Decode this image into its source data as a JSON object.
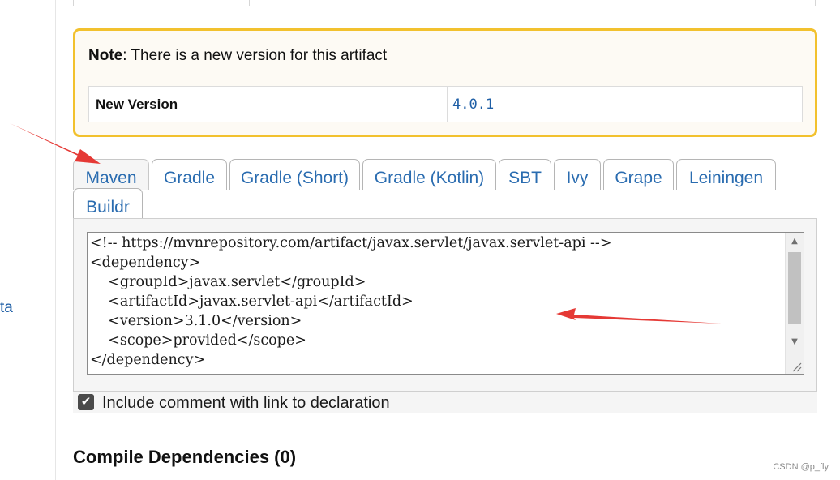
{
  "sidebar": {
    "partial_link": "ta"
  },
  "note": {
    "label": "Note",
    "message": ": There is a new version for this artifact",
    "row_label": "New Version",
    "row_value": "4.0.1"
  },
  "tabs": [
    {
      "label": "Maven",
      "active": true
    },
    {
      "label": "Gradle"
    },
    {
      "label": "Gradle (Short)"
    },
    {
      "label": "Gradle (Kotlin)"
    },
    {
      "label": "SBT"
    },
    {
      "label": "Ivy"
    },
    {
      "label": "Grape"
    },
    {
      "label": "Leiningen"
    },
    {
      "label": "Buildr"
    }
  ],
  "code": {
    "lines": [
      "<!-- https://mvnrepository.com/artifact/javax.servlet/javax.servlet-api -->",
      "<dependency>",
      "    <groupId>javax.servlet</groupId>",
      "    <artifactId>javax.servlet-api</artifactId>",
      "    <version>3.1.0</version>",
      "    <scope>provided</scope>",
      "</dependency>"
    ]
  },
  "include_comment": {
    "label": "Include comment with link to declaration",
    "checked": true
  },
  "section": {
    "title": "Compile Dependencies (0)"
  },
  "watermark": "CSDN @p_fly",
  "colors": {
    "accent": "#f2c12e",
    "link": "#1f5fa6",
    "annotation_arrow": "#e53935"
  }
}
